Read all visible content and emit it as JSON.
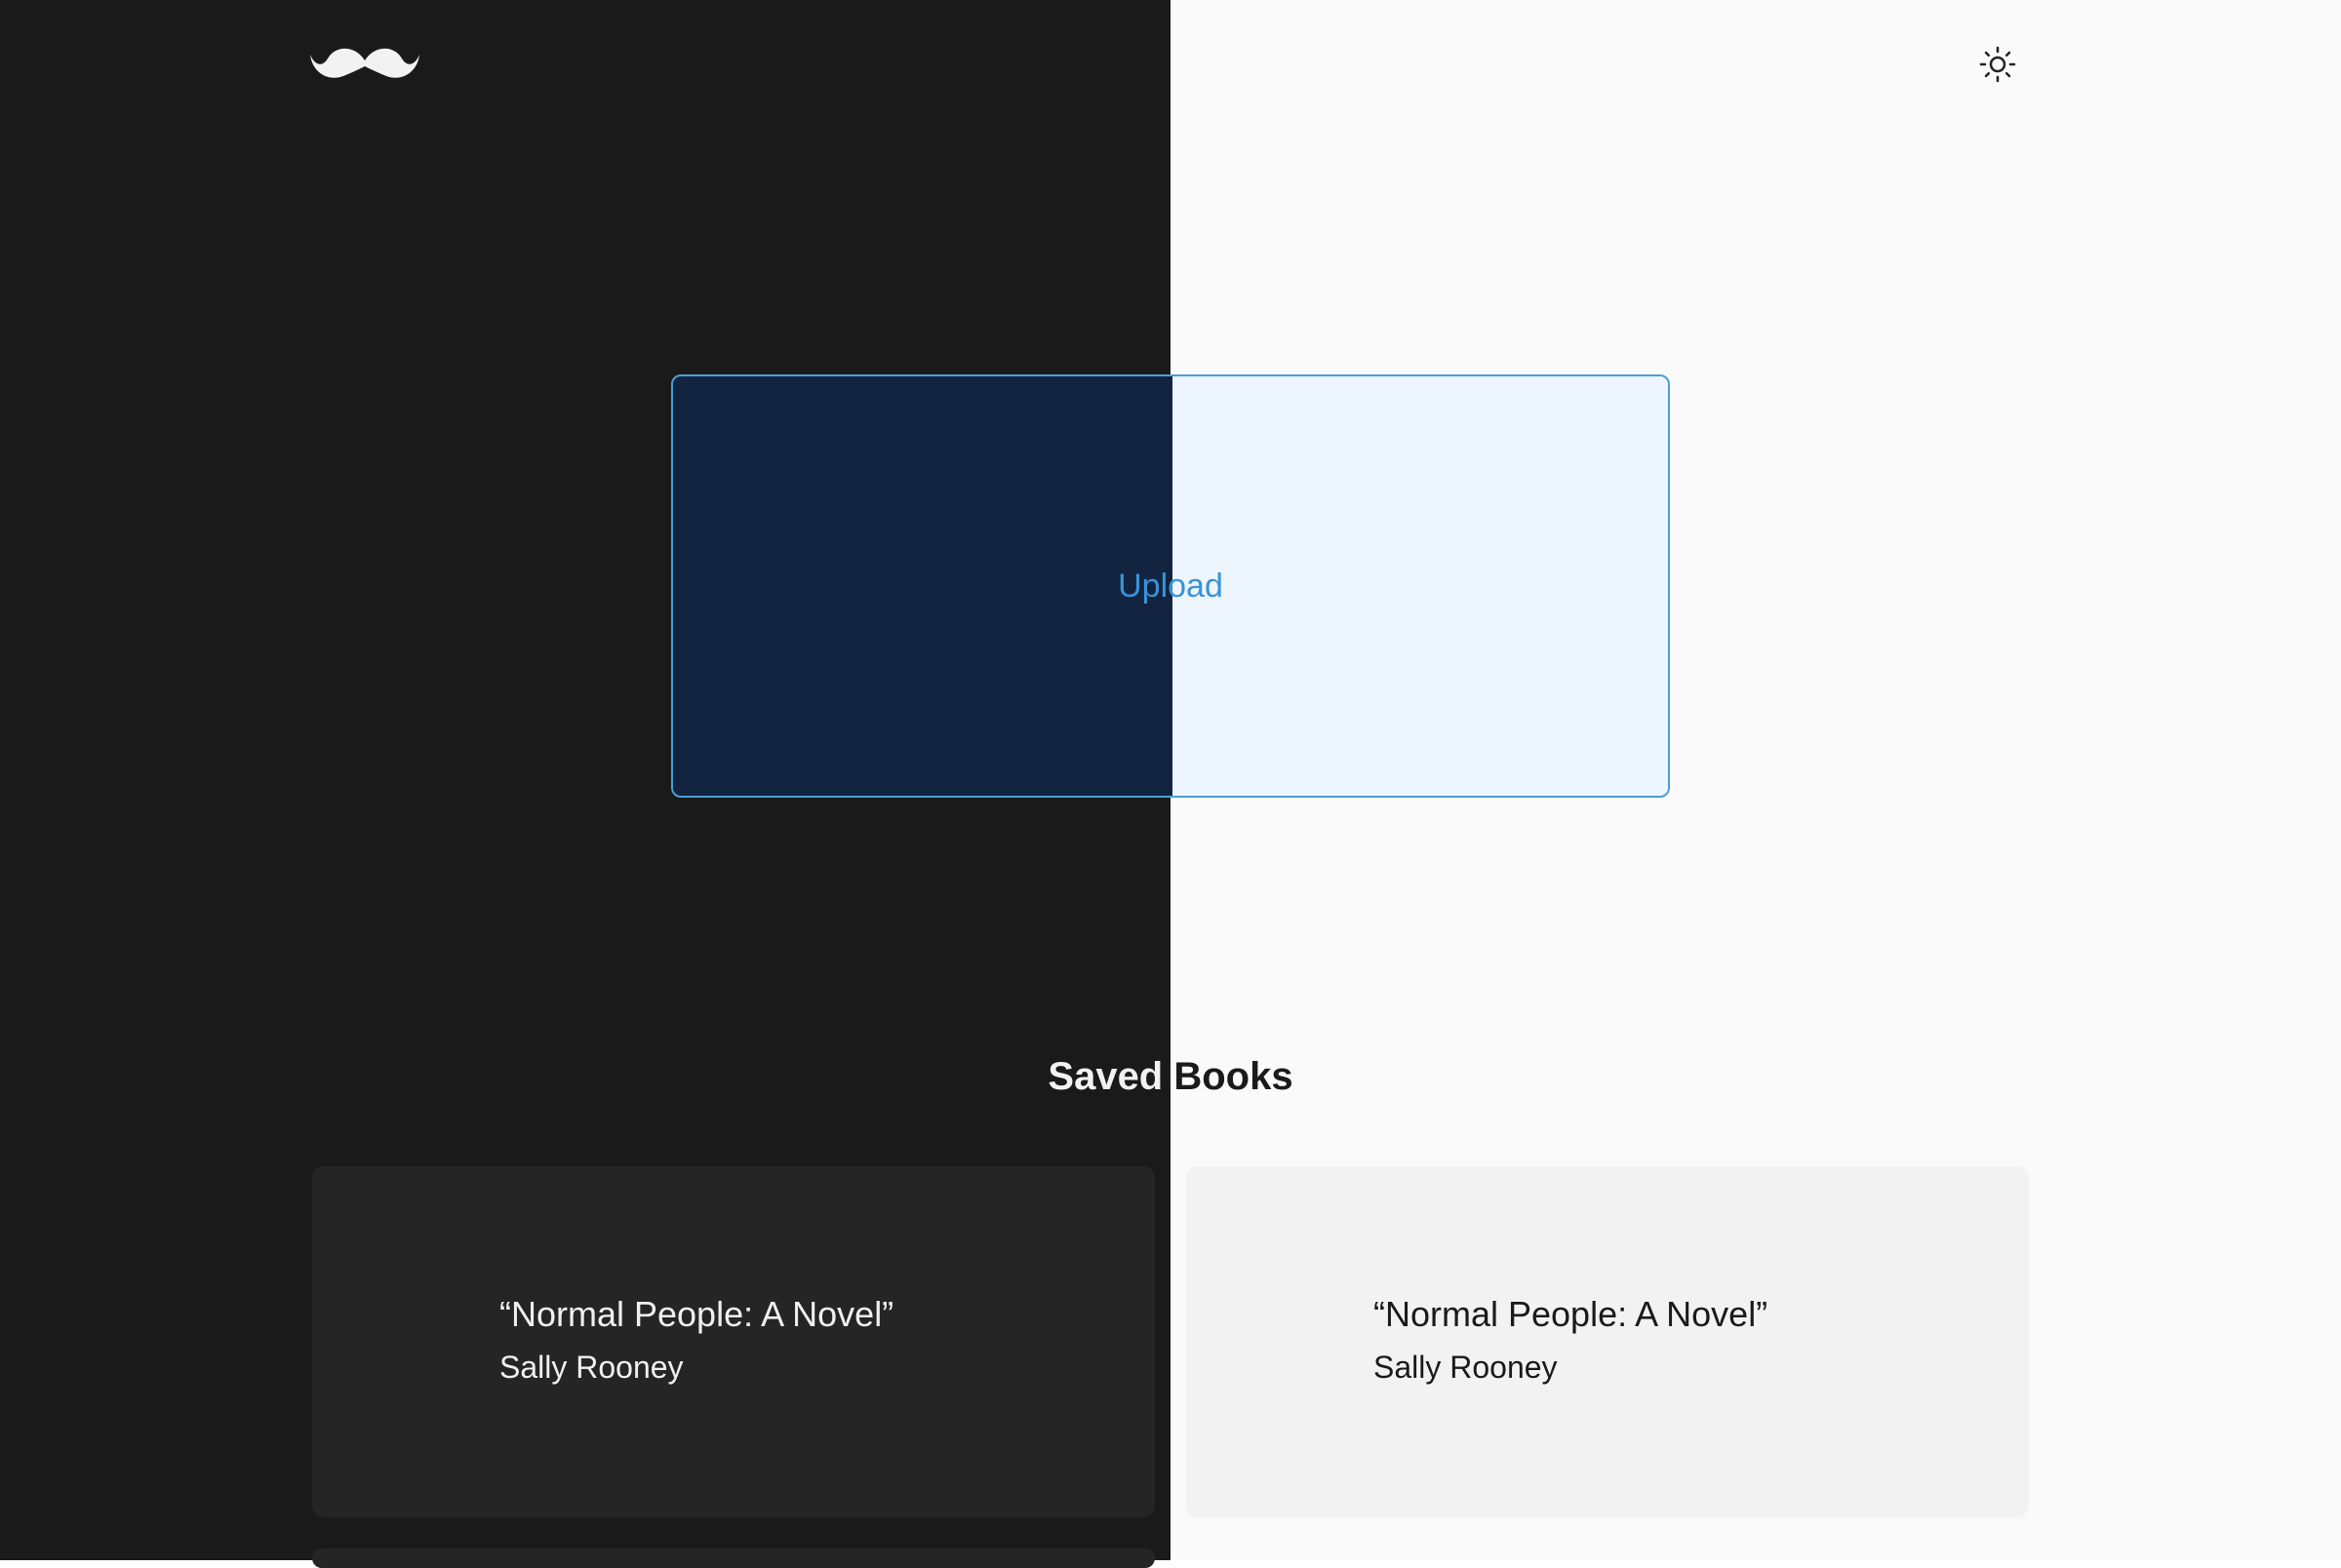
{
  "header": {
    "logo_icon": "mustache-icon",
    "theme_toggle_icon": "sun-icon"
  },
  "upload": {
    "label": "Upload"
  },
  "saved_books": {
    "title": "Saved Books",
    "books": [
      {
        "title": "“Normal People: A Novel”",
        "author": "Sally Rooney"
      },
      {
        "title": "“Normal People: A Novel”",
        "author": "Sally Rooney"
      }
    ]
  },
  "colors": {
    "dark_bg": "#1a1a1a",
    "light_bg": "#fafafa",
    "accent": "#3a93d8",
    "dark_card": "#252525",
    "light_card": "#f2f2f2"
  }
}
